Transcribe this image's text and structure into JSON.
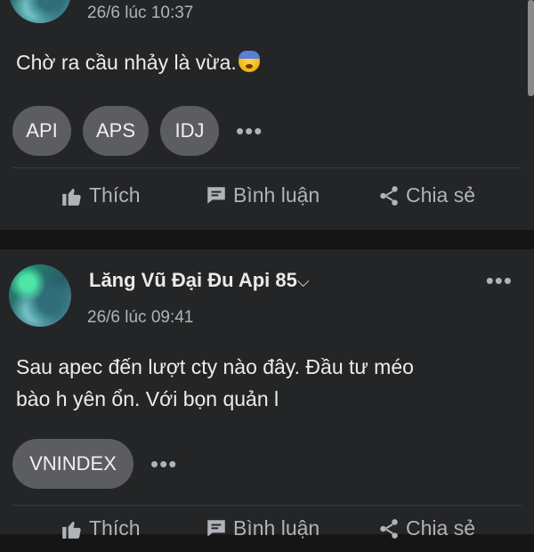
{
  "posts": [
    {
      "timestamp": "26/6 lúc 10:37",
      "content": "Chờ ra cầu nhảy là vừa.",
      "emoji": "anxious-face-with-sweat",
      "tags": [
        "API",
        "APS",
        "IDJ"
      ],
      "more_label": "•••",
      "actions": {
        "like": "Thích",
        "comment": "Bình luận",
        "share": "Chia sẻ"
      }
    },
    {
      "author": "Lăng Vũ Đại Đu Api 85",
      "author_suffix_glyph": "⌵",
      "timestamp": "26/6 lúc 09:41",
      "content_line1": "Sau apec đến lượt cty nào đây. Đầu tư méo",
      "content_line2": "bào h yên ổn. Với bọn quản l",
      "tags": [
        "VNINDEX"
      ],
      "more_label": "•••",
      "menu_label": "•••",
      "actions": {
        "like": "Thích",
        "comment": "Bình luận",
        "share": "Chia sẻ"
      }
    }
  ],
  "colors": {
    "background": "#151515",
    "card": "#242526",
    "tag": "#5c5d60",
    "muted": "#b0b3b8"
  }
}
